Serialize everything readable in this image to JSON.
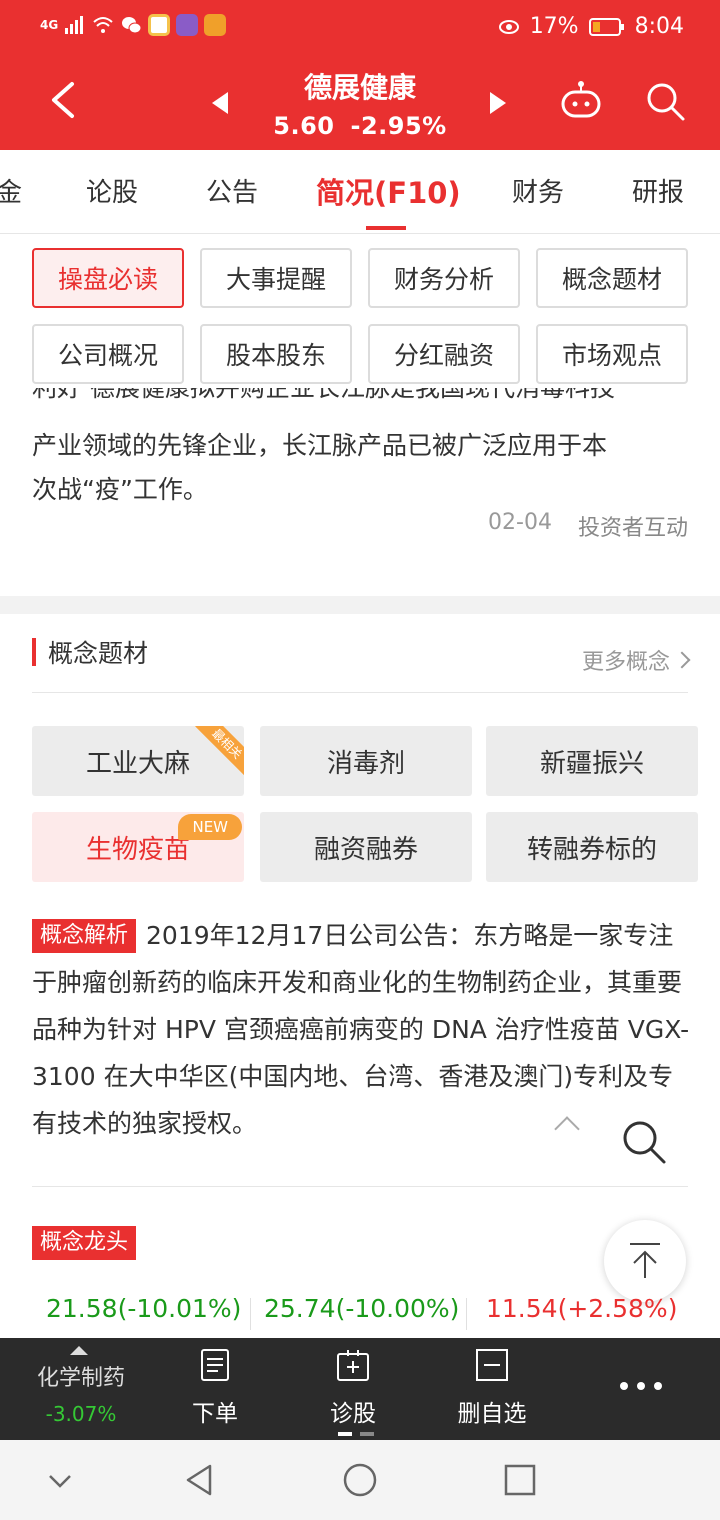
{
  "status_bar": {
    "network": "4G",
    "battery": "17%",
    "time": "8:04"
  },
  "header": {
    "stock_name": "德展健康",
    "price": "5.60",
    "change": "-2.95%",
    "colors": {
      "bg": "#e93030"
    }
  },
  "tabs": [
    {
      "label": "金"
    },
    {
      "label": "论股"
    },
    {
      "label": "公告"
    },
    {
      "label": "简况(F10)",
      "active": true
    },
    {
      "label": "财务"
    },
    {
      "label": "研报"
    }
  ],
  "grid_buttons": [
    {
      "label": "操盘必读",
      "active": true
    },
    {
      "label": "大事提醒"
    },
    {
      "label": "财务分析"
    },
    {
      "label": "概念题材"
    },
    {
      "label": "公司概况"
    },
    {
      "label": "股本股东"
    },
    {
      "label": "分红融资"
    },
    {
      "label": "市场观点"
    }
  ],
  "news": {
    "clipped_line": "利好 德展健康拟并购企业长江脉是我国现代消毒科技",
    "text_line1": "产业领域的先锋企业，长江脉产品已被广泛应用于本",
    "text_line2": "次战“疫”工作。",
    "date": "02-04",
    "source": "投资者互动"
  },
  "concept_section": {
    "title": "概念题材",
    "more": "更多概念",
    "items": [
      {
        "label": "工业大麻",
        "ribbon": "最相关"
      },
      {
        "label": "消毒剂"
      },
      {
        "label": "新疆振兴"
      },
      {
        "label": "生物疫苗",
        "badge": "NEW",
        "highlight": true
      },
      {
        "label": "融资融券"
      },
      {
        "label": "转融券标的"
      }
    ],
    "analysis_tag": "概念解析",
    "analysis_text": "2019年12月17日公司公告：东方略是一家专注于肿瘤创新药的临床开发和商业化的生物制药企业，其重要品种为针对 HPV 宫颈癌癌前病变的 DNA 治疗性疫苗 VGX-3100 在大中华区(中国内地、台湾、香港及澳门)专利及专有技术的独家授权。",
    "leader_tag": "概念龙头",
    "quotes": [
      {
        "value": "21.58(-10.01%)",
        "dir": "down"
      },
      {
        "value": "25.74(-10.00%)",
        "dir": "down"
      },
      {
        "value": "11.54(+2.58%)",
        "dir": "up"
      }
    ]
  },
  "toolbar": {
    "sector": "化学制药",
    "sector_change": "-3.07%",
    "items": [
      {
        "label": "下单",
        "icon": "order-icon"
      },
      {
        "label": "诊股",
        "icon": "diagnose-icon"
      },
      {
        "label": "删自选",
        "icon": "remove-watchlist-icon"
      }
    ]
  }
}
